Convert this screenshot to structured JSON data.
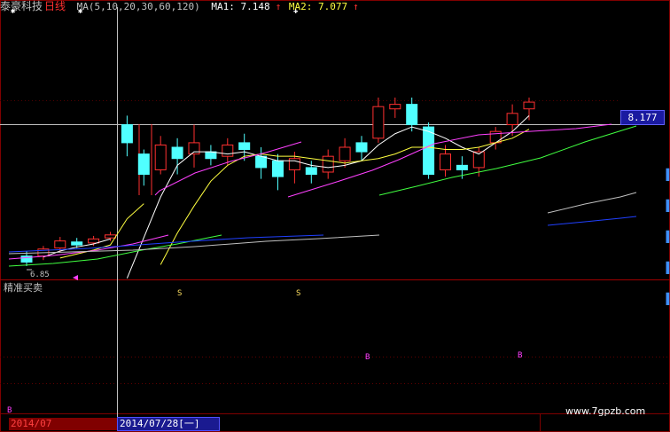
{
  "header": {
    "stock_name": "泰豪科技",
    "period": "日线",
    "ma_params": "MA(5,10,20,30,60,120)",
    "ma1_label": "MA1: 7.148",
    "ma2_label": "MA2: 7.077",
    "up_arrow": "↑"
  },
  "subchart_title": "精准买卖",
  "price_box": "8.177",
  "low_label": "6.85",
  "date_left": "2014/07",
  "date_cursor": "2014/07/28[一]",
  "watermark": "www.7gpzb.com",
  "signal_s": "S",
  "signal_b": "B",
  "colors": {
    "up": "#ff3030",
    "down": "#50ffff",
    "ma5": "#ffffff",
    "ma10": "#ffff40",
    "ma20": "#ff40ff",
    "ma30": "#40ff40",
    "ma60": "#c0c0c0",
    "ma120": "#2040ff",
    "grid": "#800000"
  },
  "chart_data": {
    "type": "candlestick",
    "title": "泰豪科技 日线",
    "y_reference": 8.177,
    "low_marker": 6.85,
    "cursor_date": "2014/07/28",
    "candles": [
      {
        "o": 6.88,
        "c": 6.82,
        "h": 6.93,
        "l": 6.78
      },
      {
        "o": 6.88,
        "c": 6.95,
        "h": 6.98,
        "l": 6.84
      },
      {
        "o": 6.96,
        "c": 7.03,
        "h": 7.07,
        "l": 6.92
      },
      {
        "o": 7.02,
        "c": 6.99,
        "h": 7.06,
        "l": 6.96
      },
      {
        "o": 7.01,
        "c": 7.05,
        "h": 7.08,
        "l": 6.98
      },
      {
        "o": 7.06,
        "c": 7.09,
        "h": 7.12,
        "l": 7.03
      },
      {
        "o": 8.18,
        "c": 8.1,
        "h": 8.22,
        "l": 8.04
      },
      {
        "o": 8.05,
        "c": 7.96,
        "h": 8.07,
        "l": 7.91
      },
      {
        "o": 7.98,
        "c": 8.09,
        "h": 8.13,
        "l": 7.96
      },
      {
        "o": 8.08,
        "c": 8.03,
        "h": 8.12,
        "l": 7.96
      },
      {
        "o": 8.05,
        "c": 8.1,
        "h": 8.18,
        "l": 7.99
      },
      {
        "o": 8.06,
        "c": 8.03,
        "h": 8.09,
        "l": 8.0
      },
      {
        "o": 8.04,
        "c": 8.09,
        "h": 8.12,
        "l": 8.0
      },
      {
        "o": 8.1,
        "c": 8.07,
        "h": 8.14,
        "l": 8.02
      },
      {
        "o": 8.04,
        "c": 7.99,
        "h": 8.08,
        "l": 7.94
      },
      {
        "o": 8.02,
        "c": 7.95,
        "h": 8.05,
        "l": 7.89
      },
      {
        "o": 7.98,
        "c": 8.03,
        "h": 8.06,
        "l": 7.92
      },
      {
        "o": 7.99,
        "c": 7.96,
        "h": 8.02,
        "l": 7.92
      },
      {
        "o": 7.97,
        "c": 8.04,
        "h": 8.07,
        "l": 7.94
      },
      {
        "o": 8.02,
        "c": 8.08,
        "h": 8.12,
        "l": 7.99
      },
      {
        "o": 8.1,
        "c": 8.06,
        "h": 8.13,
        "l": 8.02
      },
      {
        "o": 8.12,
        "c": 8.26,
        "h": 8.3,
        "l": 8.1
      },
      {
        "o": 8.25,
        "c": 8.27,
        "h": 8.3,
        "l": 8.21
      },
      {
        "o": 8.27,
        "c": 8.18,
        "h": 8.3,
        "l": 8.15
      },
      {
        "o": 8.17,
        "c": 7.96,
        "h": 8.19,
        "l": 7.94
      },
      {
        "o": 7.98,
        "c": 8.05,
        "h": 8.09,
        "l": 7.95
      },
      {
        "o": 8.0,
        "c": 7.98,
        "h": 8.04,
        "l": 7.94
      },
      {
        "o": 7.99,
        "c": 8.06,
        "h": 8.08,
        "l": 7.95
      },
      {
        "o": 8.1,
        "c": 8.15,
        "h": 8.17,
        "l": 8.07
      },
      {
        "o": 8.18,
        "c": 8.23,
        "h": 8.27,
        "l": 8.13
      },
      {
        "o": 8.25,
        "c": 8.28,
        "h": 8.3,
        "l": 8.2
      }
    ],
    "series": [
      {
        "name": "MA1",
        "color": "#ffffff",
        "values": [
          null,
          6.87,
          6.93,
          6.97,
          7.0,
          7.05,
          7.5,
          7.68,
          7.86,
          8.0,
          8.06,
          8.06,
          8.05,
          8.06,
          8.04,
          8.02,
          8.02,
          8.0,
          7.99,
          8.0,
          8.02,
          8.09,
          8.14,
          8.17,
          8.15,
          8.12,
          8.08,
          8.05,
          8.1,
          8.15,
          8.22
        ]
      },
      {
        "name": "MA2",
        "color": "#ffff40",
        "values": [
          null,
          null,
          6.86,
          6.9,
          6.94,
          6.99,
          7.25,
          7.4,
          7.56,
          7.7,
          7.82,
          7.93,
          8.0,
          8.04,
          8.05,
          8.04,
          8.04,
          8.03,
          8.02,
          8.01,
          8.02,
          8.03,
          8.05,
          8.08,
          8.08,
          8.07,
          8.07,
          8.08,
          8.1,
          8.12,
          8.16
        ]
      }
    ]
  }
}
